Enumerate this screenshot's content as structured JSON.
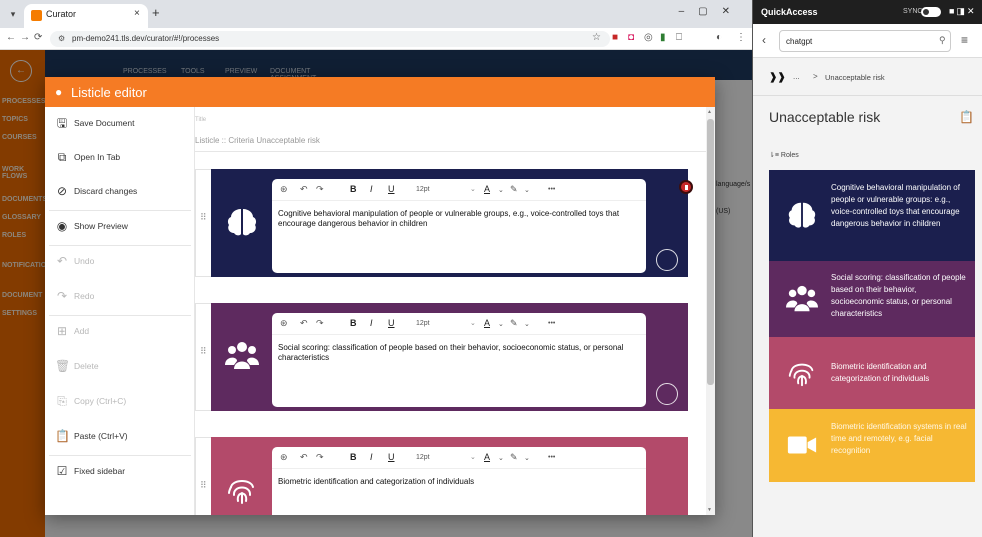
{
  "browser": {
    "tab_title": "Curator",
    "tab_close": "×",
    "new_tab": "+",
    "url": "pm-demo241.tls.dev/curator/#!/processes"
  },
  "app": {
    "sidebar_items": [
      "PROCESSES",
      "TOPICS",
      "COURSES",
      "WORK FLOWS",
      "DOCUMENTS",
      "GLOSSARY",
      "ROLES",
      "NOTIFICATIONS",
      "DOCUMENT",
      "SETTINGS"
    ],
    "top_tabs": [
      "PROCESSES",
      "TOOLS",
      "PREVIEW",
      "DOCUMENT ASSIGNMENT"
    ],
    "bg_language": "language/s",
    "bg_us": "(US)"
  },
  "modal": {
    "title": "Listicle editor",
    "menu": [
      {
        "label": "Save Document",
        "icon": "save-icon",
        "enabled": true
      },
      {
        "label": "Open In Tab",
        "icon": "open-in-tab-icon",
        "enabled": true
      },
      {
        "label": "Discard changes",
        "icon": "discard-icon",
        "enabled": true
      },
      {
        "label": "Show Preview",
        "icon": "eye-icon",
        "enabled": true
      },
      {
        "label": "Undo",
        "icon": "undo-icon",
        "enabled": false
      },
      {
        "label": "Redo",
        "icon": "redo-icon",
        "enabled": false
      },
      {
        "label": "Add",
        "icon": "add-icon",
        "enabled": false
      },
      {
        "label": "Delete",
        "icon": "delete-icon",
        "enabled": false
      },
      {
        "label": "Copy (Ctrl+C)",
        "icon": "copy-icon",
        "enabled": false
      },
      {
        "label": "Paste (Ctrl+V)",
        "icon": "paste-icon",
        "enabled": true
      },
      {
        "label": "Fixed sidebar",
        "icon": "checkbox-icon",
        "enabled": true
      }
    ],
    "title_field_label": "Title",
    "title_field_value": "Listicle :: Criteria Unacceptable risk",
    "editor_toolbar": {
      "bold": "B",
      "italic": "I",
      "underline": "U",
      "font_size": "12pt",
      "more": "•••"
    },
    "cards": [
      {
        "color": "#1b1f4e",
        "icon": "brain-icon",
        "text": "Cognitive behavioral manipulation of people or vulnerable groups, e.g., voice-controlled toys that encourage dangerous behavior in children"
      },
      {
        "color": "#5e2a5f",
        "icon": "people-icon",
        "text": "Social scoring: classification of people based on their behavior, socioeconomic status, or personal characteristics"
      },
      {
        "color": "#b34a6a",
        "icon": "fingerprint-icon",
        "text": "Biometric identification and categorization of individuals"
      }
    ]
  },
  "quickaccess": {
    "title": "QuickAccess",
    "sync_label": "SYNC",
    "search_value": "chatgpt",
    "breadcrumb_ellipsis": "...",
    "breadcrumb_arrow": ">",
    "breadcrumb_current": "Unacceptable risk",
    "heading": "Unacceptable risk",
    "roles_label": "Roles",
    "cards": [
      {
        "color": "#1b1f4e",
        "icon": "brain-icon",
        "text": "Cognitive behavioral manipulation of people or vulnerable groups: e.g., voice-controlled toys that encourage dangerous behavior in children"
      },
      {
        "color": "#5e2a5f",
        "icon": "people-icon",
        "text": "Social scoring: classification of people based on their behavior, socioeconomic status, or personal characteristics"
      },
      {
        "color": "#b34a6a",
        "icon": "fingerprint-icon",
        "text": "Biometric identification and categorization of individuals"
      },
      {
        "color": "#f6b833",
        "icon": "video-camera-icon",
        "text": "Biometric identification systems in real time and remotely, e.g. facial recognition"
      }
    ]
  }
}
